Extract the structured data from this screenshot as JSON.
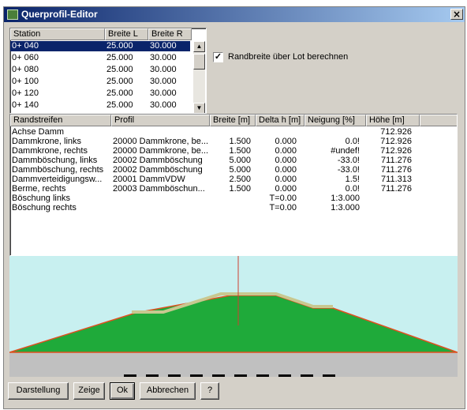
{
  "window": {
    "title": "Querprofil-Editor",
    "close_glyph": "×"
  },
  "stations": {
    "headers": [
      "Station",
      "Breite L",
      "Breite R"
    ],
    "rows": [
      [
        "0+ 040",
        "25.000",
        "30.000"
      ],
      [
        "0+ 060",
        "25.000",
        "30.000"
      ],
      [
        "0+ 080",
        "25.000",
        "30.000"
      ],
      [
        "0+ 100",
        "25.000",
        "30.000"
      ],
      [
        "0+ 120",
        "25.000",
        "30.000"
      ],
      [
        "0+ 140",
        "25.000",
        "30.000"
      ]
    ],
    "selected_index": 0
  },
  "options": {
    "randbreite_label": "Randbreite über Lot berechnen",
    "randbreite_checked": true,
    "check_glyph": "✓"
  },
  "randstreifen": {
    "headers": [
      "Randstreifen",
      "Profil",
      "Breite [m]",
      "Delta h [m]",
      "Neigung [%]",
      "Höhe [m]"
    ],
    "rows": [
      [
        "Achse Damm",
        "",
        "",
        "",
        "",
        "712.926"
      ],
      [
        "Dammkrone, links",
        "20000 Dammkrone, be...",
        "1.500",
        "0.000",
        "0.0!",
        "712.926"
      ],
      [
        "Dammkrone, rechts",
        "20000 Dammkrone, be...",
        "1.500",
        "0.000",
        "#undef!",
        "712.926"
      ],
      [
        "Dammböschung, links",
        "20002 Dammböschung",
        "5.000",
        "0.000",
        "-33.0!",
        "711.276"
      ],
      [
        "Dammböschung, rechts",
        "20002 Dammböschung",
        "5.000",
        "0.000",
        "-33.0!",
        "711.276"
      ],
      [
        "Dammverteidigungsw...",
        "20001 DammVDW",
        "2.500",
        "0.000",
        "1.5!",
        "711.313"
      ],
      [
        "Berme, rechts",
        "20003 Dammböschun...",
        "1.500",
        "0.000",
        "0.0!",
        "711.276"
      ],
      [
        "Böschung links",
        "",
        "",
        "T=0.00",
        "1:3.000",
        ""
      ],
      [
        "Böschung rechts",
        "",
        "",
        "T=0.00",
        "1:3.000",
        ""
      ]
    ]
  },
  "profile_colors": {
    "sky": "#c8f0f0",
    "fill": "#1faa3a",
    "outline": "#e05020",
    "crest": "#c8c890",
    "ground": "#c0c0c0",
    "axis": "#d04030"
  },
  "buttons": {
    "darstellung": "Darstellung",
    "zeige": "Zeige",
    "ok": "Ok",
    "abbrechen": "Abbrechen",
    "help": "?"
  }
}
